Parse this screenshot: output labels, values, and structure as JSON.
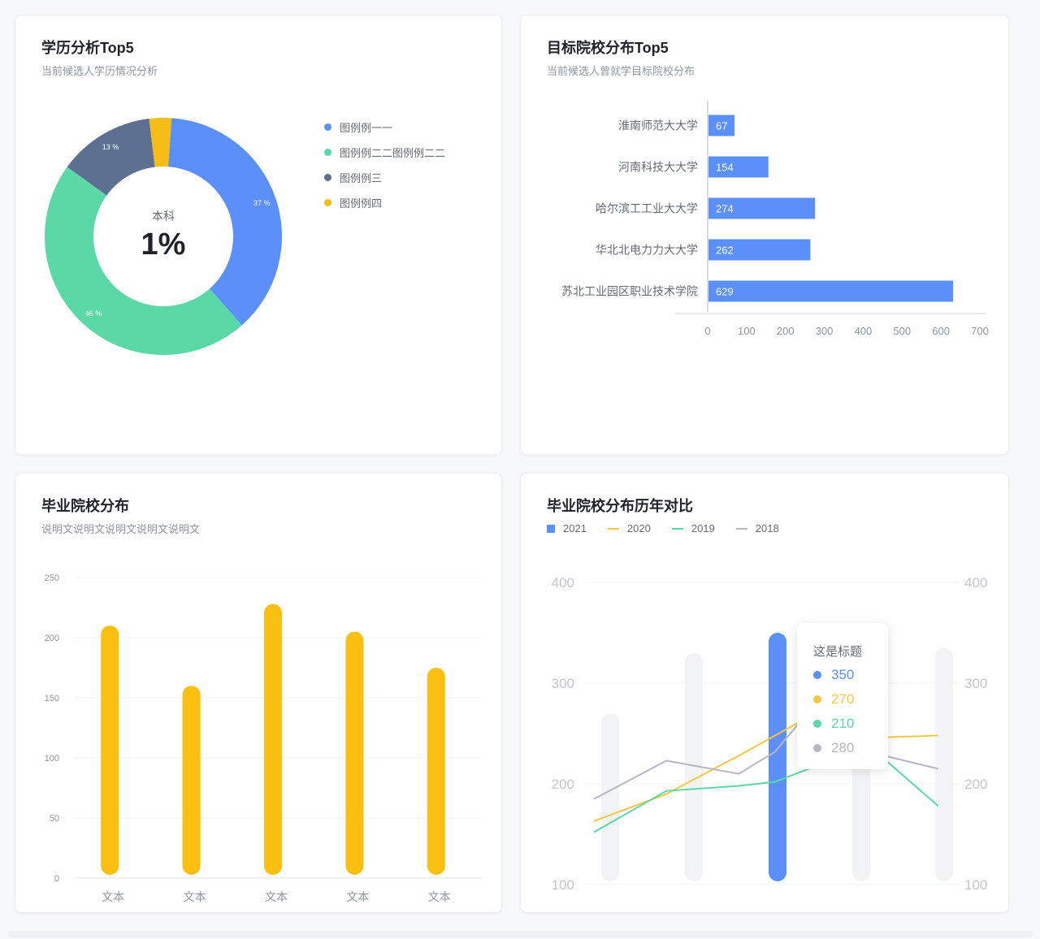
{
  "cards": {
    "edu": {
      "title": "学历分析Top5",
      "subtitle": "当前候选人学历情况分析"
    },
    "target": {
      "title": "目标院校分布Top5",
      "subtitle": "当前候选人曾就学目标院校分布"
    },
    "grad": {
      "title": "毕业院校分布",
      "subtitle": "说明文说明文说明文说明文说明文"
    },
    "compare": {
      "title": "毕业院校分布历年对比"
    }
  },
  "chart_data": [
    {
      "type": "pie",
      "donut": true,
      "center_label": "本科",
      "center_value": "1%",
      "slices": [
        {
          "name": "图例例一一",
          "value": 37,
          "label": "37 %",
          "color": "#5b8ff9"
        },
        {
          "name": "图例例二二图例例二二",
          "value": 46,
          "label": "46 %",
          "color": "#5ad8a6"
        },
        {
          "name": "图例例三",
          "value": 13,
          "label": "13 %",
          "color": "#5d7092"
        },
        {
          "name": "图例例四",
          "value": 3,
          "label": "",
          "color": "#f6bd16"
        }
      ],
      "legend_position": "right"
    },
    {
      "type": "bar",
      "orientation": "horizontal",
      "categories": [
        "淮南师范大大学",
        "河南科技大大学",
        "哈尔滨工工业大大学",
        "华北北电力力大大学",
        "苏北工业园区职业技术学院"
      ],
      "values": [
        67,
        154,
        274,
        262,
        629
      ],
      "xlim": [
        0,
        700
      ],
      "xticks": [
        0,
        100,
        200,
        300,
        400,
        500,
        600,
        700
      ],
      "color": "#5b8ff9"
    },
    {
      "type": "bar",
      "categories": [
        "文本",
        "文本",
        "文本",
        "文本",
        "文本"
      ],
      "values": [
        210,
        160,
        228,
        205,
        175
      ],
      "ylim": [
        0,
        250
      ],
      "yticks": [
        0,
        50,
        100,
        150,
        200,
        250
      ],
      "color": "#fbbf0f",
      "grid": true
    },
    {
      "type": "line",
      "legend": [
        {
          "name": "2021",
          "color": "#5b8ff9",
          "marker": "square"
        },
        {
          "name": "2020",
          "color": "#f7c744",
          "marker": "line"
        },
        {
          "name": "2019",
          "color": "#5ad8a6",
          "marker": "line"
        },
        {
          "name": "2018",
          "color": "#b5b8c2",
          "marker": "line"
        }
      ],
      "ylim": [
        100,
        400
      ],
      "yticks": [
        100,
        200,
        300,
        400
      ],
      "bars": [
        {
          "value": 270,
          "highlight": false
        },
        {
          "value": 330,
          "highlight": false
        },
        {
          "value": 350,
          "highlight": true
        },
        {
          "value": 270,
          "highlight": false
        },
        {
          "value": 335,
          "highlight": false
        }
      ],
      "series": [
        {
          "name": "2020",
          "color": "#f7c744",
          "points": [
            [
              0,
              163
            ],
            [
              0.2,
              190
            ],
            [
              0.4,
              228
            ],
            [
              0.6,
              268
            ],
            [
              0.7,
              245
            ],
            [
              0.95,
              248
            ]
          ]
        },
        {
          "name": "2019",
          "color": "#5ad8a6",
          "points": [
            [
              0,
              152
            ],
            [
              0.2,
              193
            ],
            [
              0.4,
              198
            ],
            [
              0.5,
              202
            ],
            [
              0.7,
              230
            ],
            [
              0.8,
              225
            ],
            [
              0.95,
              178
            ]
          ]
        },
        {
          "name": "2018",
          "color": "#b5b8c2",
          "points": [
            [
              0,
              185
            ],
            [
              0.2,
              223
            ],
            [
              0.4,
              210
            ],
            [
              0.5,
              232
            ],
            [
              0.6,
              275
            ],
            [
              0.8,
              228
            ],
            [
              0.95,
              215
            ]
          ]
        }
      ],
      "tooltip": {
        "title": "这是标题",
        "rows": [
          {
            "value": "350",
            "color": "#5b8ff9"
          },
          {
            "value": "270",
            "color": "#f7c744"
          },
          {
            "value": "210",
            "color": "#5ad8a6"
          },
          {
            "value": "280",
            "color": "#b5b8c2"
          }
        ]
      }
    }
  ]
}
